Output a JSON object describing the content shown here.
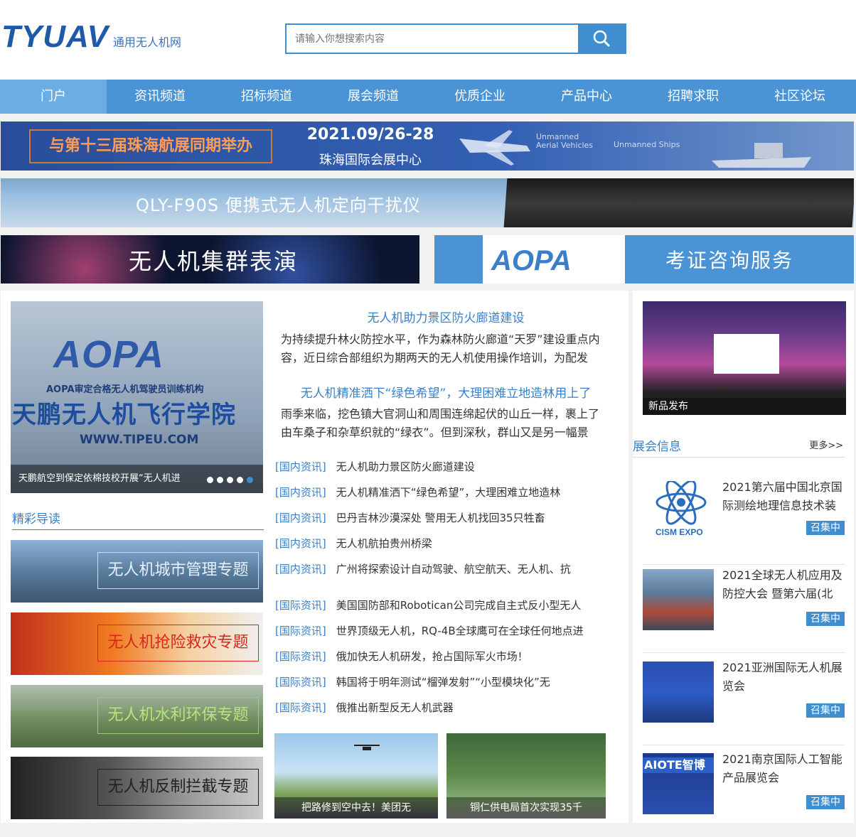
{
  "site": {
    "logo": "TYUAV",
    "logo_sub": "通用无人机网"
  },
  "search": {
    "placeholder": "请输入你想搜索内容"
  },
  "nav": [
    "门户",
    "资讯频道",
    "招标频道",
    "展会频道",
    "优质企业",
    "产品中心",
    "招聘求职",
    "社区论坛"
  ],
  "banners": {
    "zhuhai": {
      "tagline": "与第十三届珠海航展同期举办",
      "date": "2021.09/26-28",
      "venue": "珠海国际会展中心",
      "label_air": "Unmanned Aerial Vehicles",
      "label_ships": "Unmanned Ships"
    },
    "jammer": {
      "title": "QLY-F90S  便携式无人机定向干扰仪"
    },
    "swarm": {
      "title": "无人机集群表演"
    },
    "aopa": {
      "logo": "AOPA",
      "title": "考证咨询服务"
    }
  },
  "slider": {
    "logo": "AOPA",
    "cert": "AOPA审定合格无人机驾驶员训练机构",
    "school": "天鹏无人机飞行学院",
    "web": "WWW.TIPEU.COM",
    "caption": "天鹏航空到保定依棉技校开展“无人机进"
  },
  "reading": {
    "title": "精彩导读",
    "topics": [
      "无人机城市管理专题",
      "无人机抢险救灾专题",
      "无人机水利环保专题",
      "无人机反制拦截专题"
    ]
  },
  "headlines": [
    {
      "title": "无人机助力景区防火廊道建设",
      "summary": "为持续提升林火防控水平，作为森林防火廊道“天罗”建设重点内容，近日综合部组织为期两天的无人机使用操作培训，为配发"
    },
    {
      "title": "无人机精准洒下“绿色希望”，大理困难立地造林用上了",
      "summary": "雨季来临，挖色镇大官洞山和周围连绵起伏的山丘一样，裹上了由车桑子和杂草织就的“绿衣”。但到深秋，群山又是另一幅景"
    }
  ],
  "domestic": [
    {
      "cat": "[国内资讯]",
      "title": "无人机助力景区防火廊道建设"
    },
    {
      "cat": "[国内资讯]",
      "title": "无人机精准洒下“绿色希望”，大理困难立地造林"
    },
    {
      "cat": "[国内资讯]",
      "title": "巴丹吉林沙漠深处 警用无人机找回35只牲畜"
    },
    {
      "cat": "[国内资讯]",
      "title": "无人机航拍贵州桥梁"
    },
    {
      "cat": "[国内资讯]",
      "title": "广州将探索设计自动驾驶、航空航天、无人机、抗"
    }
  ],
  "international": [
    {
      "cat": "[国际资讯]",
      "title": "美国国防部和Robotican公司完成自主式反小型无人"
    },
    {
      "cat": "[国际资讯]",
      "title": "世界顶级无人机，RQ-4B全球鹰可在全球任何地点进"
    },
    {
      "cat": "[国际资讯]",
      "title": "俄加快无人机研发，抢占国际军火市场！"
    },
    {
      "cat": "[国际资讯]",
      "title": "韩国将于明年测试“榴弹发射”“小型模块化”无"
    },
    {
      "cat": "[国际资讯]",
      "title": "俄推出新型反无人机武器"
    }
  ],
  "photos": [
    {
      "caption": "把路修到空中去！美团无"
    },
    {
      "caption": "铜仁供电局首次实现35千"
    }
  ],
  "expo": {
    "image_caption": "新品发布",
    "section_title": "展会信息",
    "more": "更多>>",
    "events": [
      {
        "title": "2021第六届中国北京国际测绘地理信息技术装",
        "badge": "召集中",
        "logo": "CISM EXPO"
      },
      {
        "title": "2021全球无人机应用及防控大会 暨第六届(北",
        "badge": "召集中"
      },
      {
        "title": "2021亚洲国际无人机展览会",
        "badge": "召集中"
      },
      {
        "title": "2021南京国际人工智能产品展览会",
        "badge": "召集中",
        "logo": "AIOTE智博"
      }
    ]
  },
  "colors": {
    "brand": "#1e5aa8",
    "nav": "#4a93d4",
    "accent": "#3a80c9"
  }
}
